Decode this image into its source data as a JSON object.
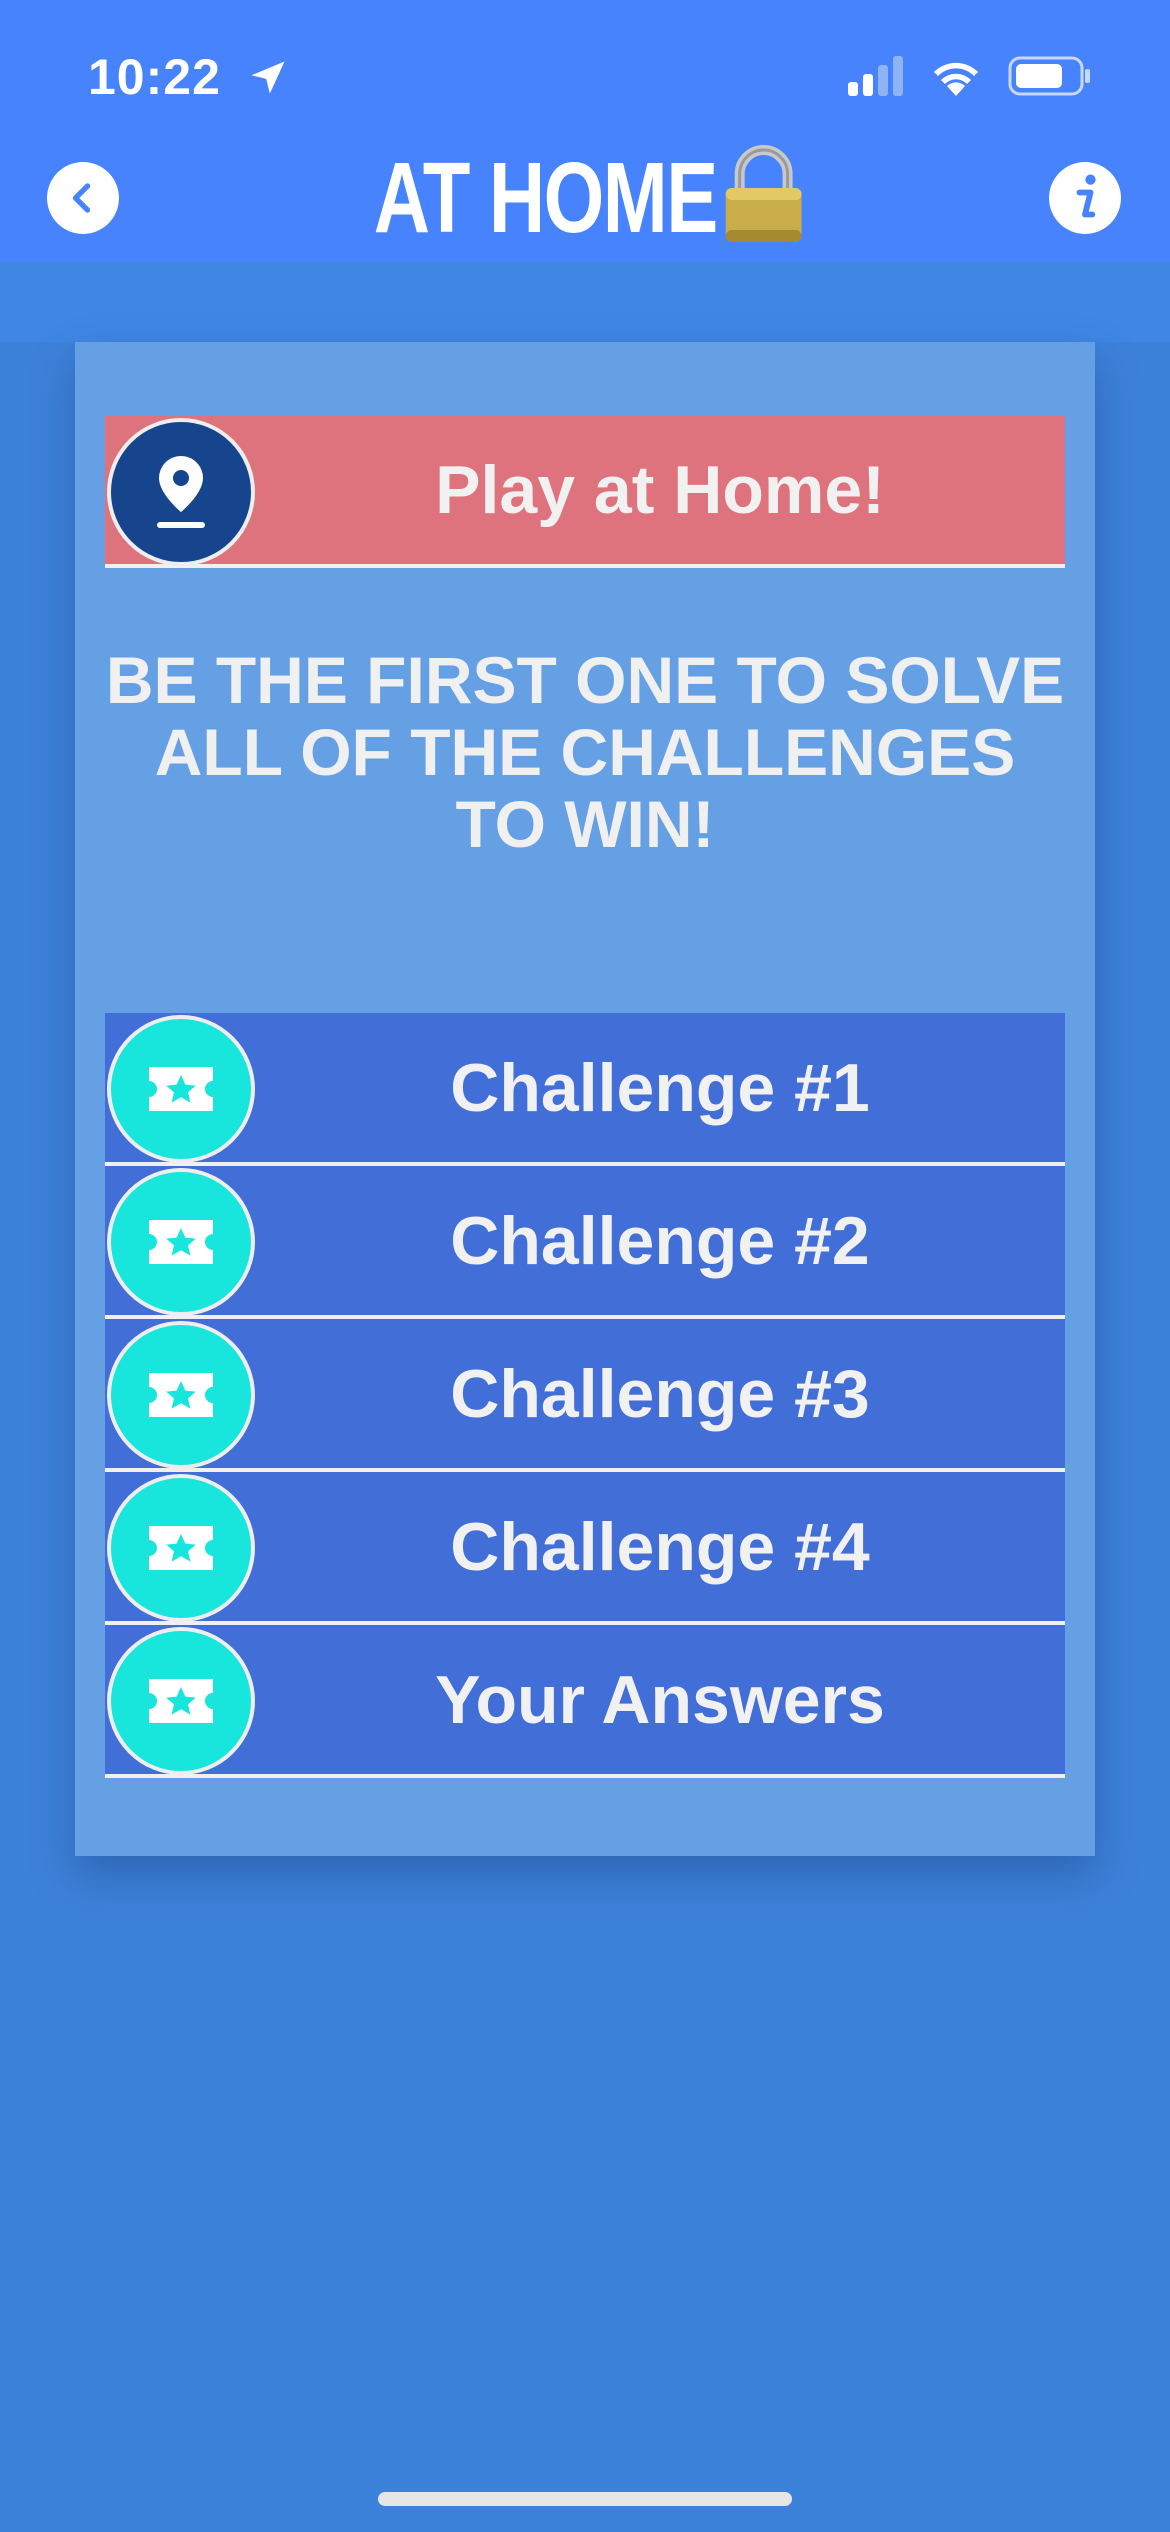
{
  "status_bar": {
    "time": "10:22"
  },
  "header": {
    "title": "AT HOME",
    "lock_icon": "🔒"
  },
  "banner": {
    "label": "Play at Home!"
  },
  "headline": "BE THE FIRST ONE TO SOLVE ALL OF THE CHALLENGES TO WIN!",
  "items": [
    {
      "label": "Challenge #1"
    },
    {
      "label": "Challenge #2"
    },
    {
      "label": "Challenge #3"
    },
    {
      "label": "Challenge #4"
    },
    {
      "label": "Your Answers"
    }
  ],
  "colors": {
    "header": "#4683fd",
    "background": "#3d82da",
    "card": "#65a0e5",
    "banner": "#de737e",
    "row": "#426ed7",
    "ticket_circle": "#18e6dc",
    "pin_circle": "#16458e"
  },
  "icons": {
    "back": "chevron-left-icon",
    "info": "info-icon",
    "banner": "location-pin-icon",
    "row": "ticket-star-icon"
  }
}
